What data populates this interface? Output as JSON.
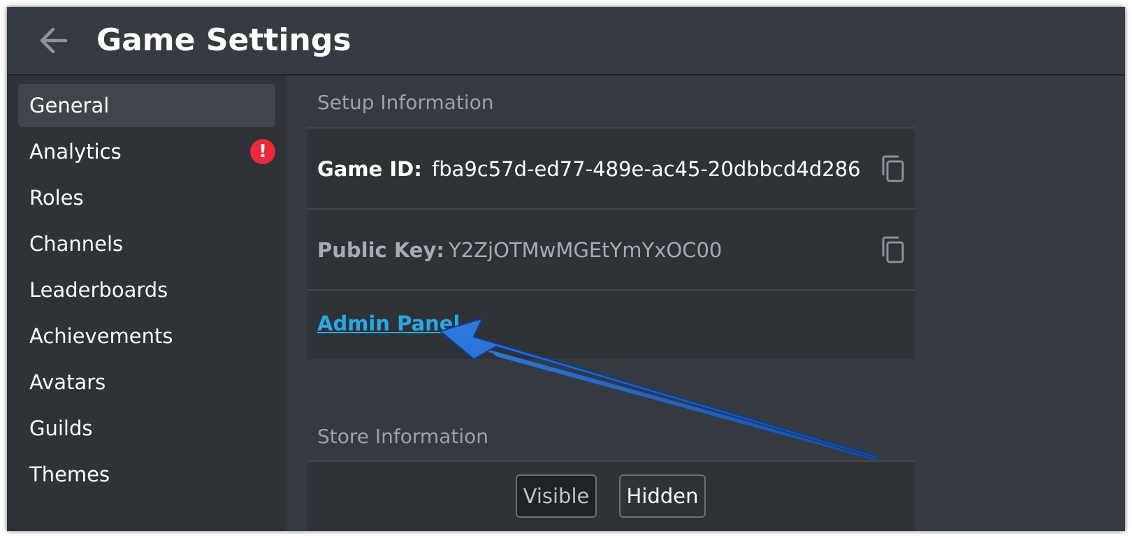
{
  "header": {
    "title": "Game Settings"
  },
  "sidebar": {
    "items": [
      {
        "label": "General",
        "active": true
      },
      {
        "label": "Analytics",
        "alert": "!"
      },
      {
        "label": "Roles"
      },
      {
        "label": "Channels"
      },
      {
        "label": "Leaderboards"
      },
      {
        "label": "Achievements"
      },
      {
        "label": "Avatars"
      },
      {
        "label": "Guilds"
      },
      {
        "label": "Themes"
      }
    ]
  },
  "setup": {
    "section_title": "Setup Information",
    "game_id_label": "Game ID:",
    "game_id_value": "fba9c57d-ed77-489e-ac45-20dbbcd4d286",
    "public_key_label": "Public Key:",
    "public_key_value": "Y2ZjOTMwMGEtYmYxOC00",
    "admin_link": "Admin Panel"
  },
  "store": {
    "section_title": "Store Information",
    "visible_label": "Visible",
    "hidden_label": "Hidden"
  },
  "colors": {
    "background": "#363a43",
    "sidebar": "#2f3237",
    "link": "#29a8e8",
    "alert": "#ed2a3b",
    "annotation_arrow": "#1f63c9"
  }
}
